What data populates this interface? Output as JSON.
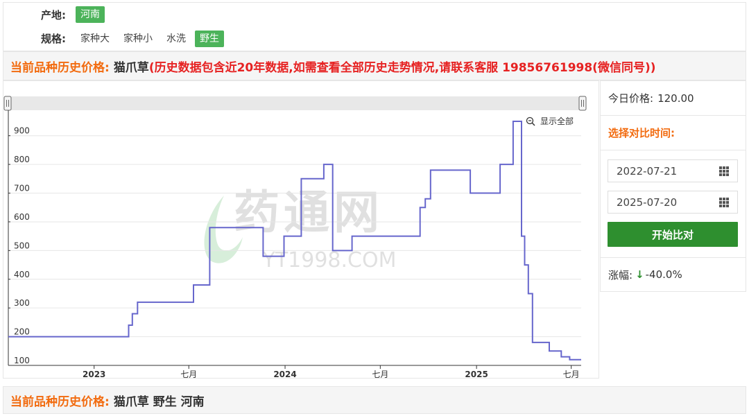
{
  "filters": {
    "origin_label": "产地:",
    "origin_options": [
      "河南"
    ],
    "spec_label": "规格:",
    "spec_options": [
      "家种大",
      "家种小",
      "水洗",
      "野生"
    ],
    "spec_selected": "野生"
  },
  "header": {
    "prefix": "当前品种历史价格:",
    "name": "猫爪草",
    "note": "(历史数据包含近20年数据,如需查看全部历史走势情况,请联系客服 19856761998(微信同号))"
  },
  "sidebar": {
    "today_label": "今日价格:",
    "today_price": "120.00",
    "compare_label": "选择对比时间:",
    "start_date": "2022-07-21",
    "end_date": "2025-07-20",
    "compare_button": "开始比对",
    "change_label": "涨幅:",
    "change_arrow": "↓",
    "change_value": "-40.0%"
  },
  "chart": {
    "show_all": "显示全部"
  },
  "watermark": {
    "cn": "药通网",
    "en": "YT1998.COM"
  },
  "footer": {
    "prefix": "当前品种历史价格:",
    "desc": "猫爪草 野生 河南"
  },
  "colors": {
    "accent_green": "#4cb35a",
    "button_green": "#2e8f2f",
    "orange": "#f26b0f",
    "red": "#e62222",
    "line": "#6666cc"
  },
  "chart_data": {
    "type": "line",
    "step": true,
    "ylim": [
      100,
      950
    ],
    "yticks": [
      100,
      200,
      300,
      400,
      500,
      600,
      700,
      800,
      900
    ],
    "xlim": [
      "2022-07-21",
      "2025-07-20"
    ],
    "xticks": [
      {
        "date": "2023-01-01",
        "label": "2023",
        "bold": true
      },
      {
        "date": "2023-07-01",
        "label": "七月",
        "bold": false
      },
      {
        "date": "2024-01-01",
        "label": "2024",
        "bold": true
      },
      {
        "date": "2024-07-01",
        "label": "七月",
        "bold": false
      },
      {
        "date": "2025-01-01",
        "label": "2025",
        "bold": true
      },
      {
        "date": "2025-07-01",
        "label": "七月",
        "bold": false
      }
    ],
    "series": [
      {
        "points": [
          [
            "2022-07-21",
            200
          ],
          [
            "2023-03-08",
            240
          ],
          [
            "2023-03-15",
            280
          ],
          [
            "2023-03-25",
            320
          ],
          [
            "2023-07-10",
            380
          ],
          [
            "2023-08-10",
            580
          ],
          [
            "2023-11-20",
            480
          ],
          [
            "2023-12-30",
            550
          ],
          [
            "2024-02-01",
            750
          ],
          [
            "2024-03-15",
            800
          ],
          [
            "2024-04-01",
            500
          ],
          [
            "2024-05-08",
            550
          ],
          [
            "2024-09-15",
            650
          ],
          [
            "2024-09-25",
            680
          ],
          [
            "2024-10-05",
            780
          ],
          [
            "2024-12-20",
            700
          ],
          [
            "2025-02-15",
            800
          ],
          [
            "2025-03-12",
            950
          ],
          [
            "2025-03-28",
            550
          ],
          [
            "2025-04-03",
            450
          ],
          [
            "2025-04-10",
            350
          ],
          [
            "2025-04-18",
            180
          ],
          [
            "2025-05-20",
            150
          ],
          [
            "2025-06-12",
            130
          ],
          [
            "2025-06-28",
            120
          ],
          [
            "2025-07-20",
            120
          ]
        ]
      }
    ]
  }
}
